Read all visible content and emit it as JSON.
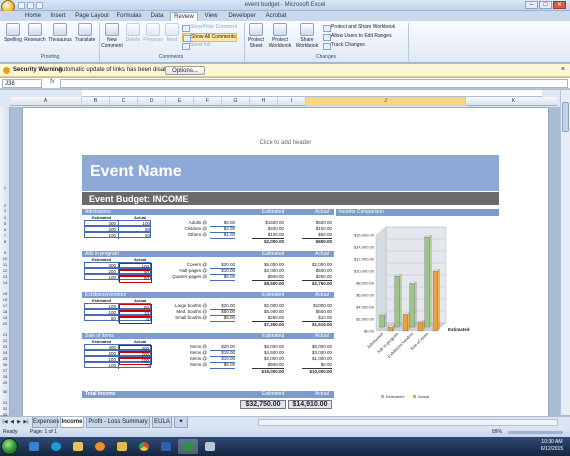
{
  "window": {
    "title": "event budget - Microsoft Excel",
    "minimize": "–",
    "maximize": "□",
    "close": "✕"
  },
  "ribbon_tabs": [
    "Home",
    "Insert",
    "Page Layout",
    "Formulas",
    "Data",
    "Review",
    "View",
    "Developer",
    "Acrobat"
  ],
  "ribbon": {
    "proofing": {
      "label": "Proofing",
      "buttons": [
        "Spelling",
        "Research",
        "Thesaurus",
        "Translate"
      ]
    },
    "comments": {
      "label": "Comments",
      "buttons": [
        "New Comment",
        "Delete",
        "Previous",
        "Next"
      ],
      "small": [
        "Show/Hide Comment",
        "Show All Comments",
        "Show Ink"
      ]
    },
    "changes": {
      "label": "Changes",
      "buttons": [
        "Protect Sheet",
        "Protect Workbook",
        "Share Workbook"
      ],
      "small": [
        "Protect and Share Workbook",
        "Allow Users to Edit Ranges",
        "Track Changes"
      ]
    }
  },
  "security": {
    "title": "Security Warning",
    "message": "Automatic update of links has been disabled",
    "options": "Options..."
  },
  "namebox": "J38",
  "fx": "fx",
  "columns": [
    "A",
    "B",
    "C",
    "D",
    "E",
    "F",
    "G",
    "H",
    "I",
    "J",
    "K"
  ],
  "rows": [
    "1",
    "2",
    "3",
    "4",
    "5",
    "6",
    "7",
    "8",
    "9",
    "10",
    "11",
    "12",
    "13",
    "14",
    "15",
    "16",
    "17",
    "18",
    "19",
    "20",
    "21",
    "22",
    "23",
    "24",
    "25",
    "26",
    "27",
    "28",
    "29",
    "30",
    "31",
    "32",
    "33"
  ],
  "page": {
    "header_placeholder": "Click to add header",
    "event_name": "Event Name",
    "budget_title": "Event Budget: INCOME",
    "estimated_h": "Estimated",
    "actual_h": "Actual",
    "sections": [
      {
        "name": "Admissions",
        "rows": [
          {
            "est": "300",
            "act": "100",
            "item": "Adults @",
            "price": "$5.00",
            "e": "$1500.00",
            "a": "$500.00"
          },
          {
            "est": "200",
            "act": "50",
            "item": "Children @",
            "price": "$2.00",
            "e": "$400.00",
            "a": "$100.00"
          },
          {
            "est": "100",
            "act": "50",
            "item": "Others @",
            "price": "$1.00",
            "e": "$100.00",
            "a": "$50.00"
          }
        ],
        "total_e": "$2,000.00",
        "total_a": "$650.00"
      },
      {
        "name": "Ads in program",
        "rows": [
          {
            "est": "300",
            "act": "100",
            "item": "Covers @",
            "price": "$20.00",
            "e": "$6,000.00",
            "a": "$2,000.00"
          },
          {
            "est": "200",
            "act": "50",
            "item": "Half-pages @",
            "price": "$10.00",
            "e": "$2,000.00",
            "a": "$500.00"
          },
          {
            "est": "100",
            "act": "50",
            "item": "Quarter-pages @",
            "price": "$5.00",
            "e": "$500.00",
            "a": "$250.00"
          }
        ],
        "total_e": "$8,500.00",
        "total_a": "$2,750.00"
      },
      {
        "name": "Exhibitors/vendors",
        "rows": [
          {
            "est": "100",
            "act": "50",
            "item": "Large booths @",
            "price": "$20.00",
            "e": "$2,000.00",
            "a": "$1000.00"
          },
          {
            "est": "100",
            "act": "10",
            "item": "Med. booths @",
            "price": "$50.00",
            "e": "$5,000.00",
            "a": "$500.00"
          },
          {
            "est": "50",
            "act": "0",
            "item": "Small booths @",
            "price": "$5.00",
            "e": "$250.00",
            "a": "$10.00"
          }
        ],
        "total_e": "$7,250.00",
        "total_a": "$1,510.00"
      },
      {
        "name": "Sale of items",
        "rows": [
          {
            "est": "400",
            "act": "300",
            "item": "Items @",
            "price": "$20.00",
            "e": "$6,000.00",
            "a": "$6,000.00"
          },
          {
            "est": "200",
            "act": "200",
            "item": "Items @",
            "price": "$15.00",
            "e": "$4,500.00",
            "a": "$3,000.00"
          },
          {
            "est": "100",
            "act": "100",
            "item": "Items @",
            "price": "$10.00",
            "e": "$2,000.00",
            "a": "$1,000.00"
          },
          {
            "est": "100",
            "act": "0",
            "item": "Items @",
            "price": "$5.00",
            "e": "$500.00",
            "a": "$0.00"
          }
        ],
        "total_e": "$15,000.00",
        "total_a": "$10,000.00"
      }
    ],
    "total_label": "Total Income",
    "total_estimated": "$32,750.00",
    "total_actual": "$14,910.00",
    "chart_heading": "Income Comparison"
  },
  "chart_data": {
    "type": "bar",
    "title": "",
    "categories": [
      "Admissions",
      "Ads in program",
      "Exhibitors/vendors",
      "Sale of items"
    ],
    "series": [
      {
        "name": "Estimated",
        "values": [
          2000,
          8500,
          7250,
          15000
        ],
        "color": "#9ec48a"
      },
      {
        "name": "Actual",
        "values": [
          650,
          2750,
          1510,
          10000
        ],
        "color": "#f0a23a"
      }
    ],
    "ylim": [
      0,
      16000
    ],
    "yticks": [
      "$0.00",
      "$2,000.00",
      "$4,000.00",
      "$6,000.00",
      "$8,000.00",
      "$10,000.00",
      "$12,000.00",
      "$14,000.00",
      "$16,000.00"
    ],
    "extra_label": "Estimated",
    "legend_position": "bottom",
    "style": "3d-column"
  },
  "sheet_tabs": [
    "Expenses",
    "Income",
    "Profit - Loss Summary",
    "EULA"
  ],
  "status": {
    "ready": "Ready",
    "page": "Page: 1 of 1",
    "zoom": "89%"
  },
  "clock": {
    "time": "10:30 AM",
    "date": "6/12/2015"
  }
}
